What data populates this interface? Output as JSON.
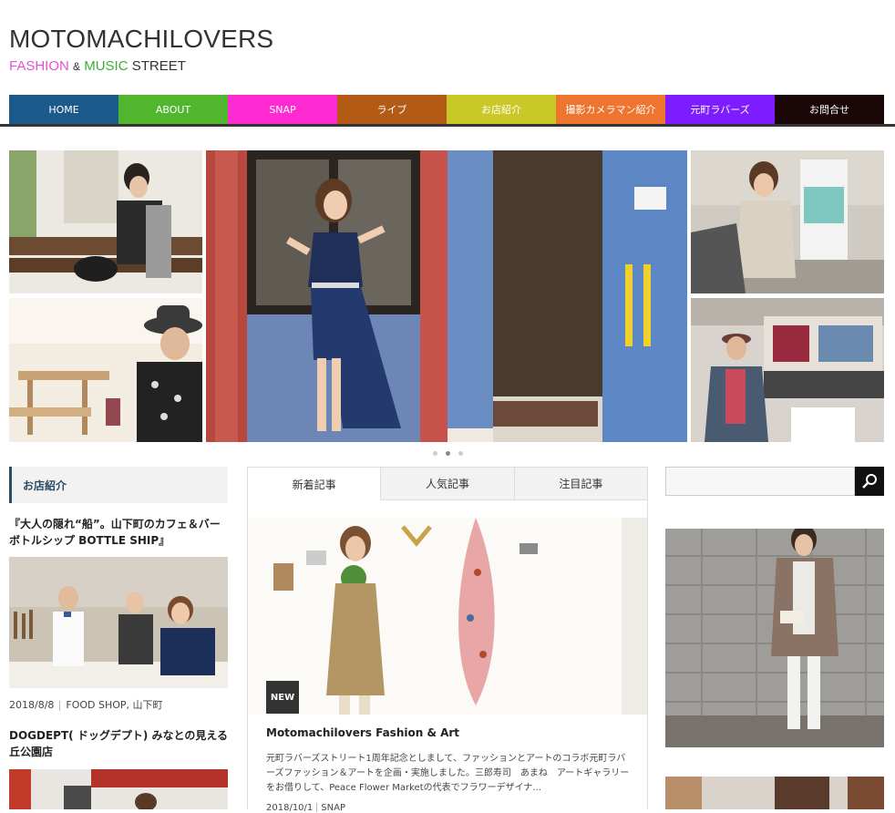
{
  "site": {
    "title": "MOTOMACHILOVERS",
    "tagline_fashion": "FASHION",
    "tagline_amp": "&",
    "tagline_music": "MUSIC",
    "tagline_street": "STREET"
  },
  "nav": [
    {
      "label": "HOME",
      "color": "#1c5a8c"
    },
    {
      "label": "ABOUT",
      "color": "#52b52e"
    },
    {
      "label": "SNAP",
      "color": "#ff2bd2"
    },
    {
      "label": "ライブ",
      "color": "#b35a15"
    },
    {
      "label": "お店紹介",
      "color": "#c9c826"
    },
    {
      "label": "撮影カメラマン紹介",
      "color": "#ee7530"
    },
    {
      "label": "元町ラバーズ",
      "color": "#7c1cff"
    },
    {
      "label": "お問合せ",
      "color": "#1a0606"
    }
  ],
  "slider": {
    "dots": 3,
    "active": 1
  },
  "sidebar_left": {
    "heading": "お店紹介",
    "posts": [
      {
        "title": "『大人の隠れ“船”。山下町のカフェ＆バー ボトルシップ BOTTLE SHIP』",
        "date": "2018/8/8",
        "categories": "FOOD SHOP, 山下町"
      },
      {
        "title": "DOGDEPT( ドッグデプト) みなとの見える丘公園店"
      }
    ]
  },
  "tabs": [
    "新着記事",
    "人気記事",
    "注目記事"
  ],
  "featured": {
    "badge": "NEW",
    "title": "Motomachilovers Fashion & Art",
    "excerpt": "元町ラバーズストリート1周年記念としまして、ファッションとアートのコラボ元町ラバーズファッション＆アートを企画・実施しました。三郎寿司　あまね　アートギャラリーをお借りして、Peace Flower Marketの代表でフラワーデザイナ...",
    "date": "2018/10/1",
    "category": "SNAP"
  },
  "search": {
    "placeholder": ""
  }
}
